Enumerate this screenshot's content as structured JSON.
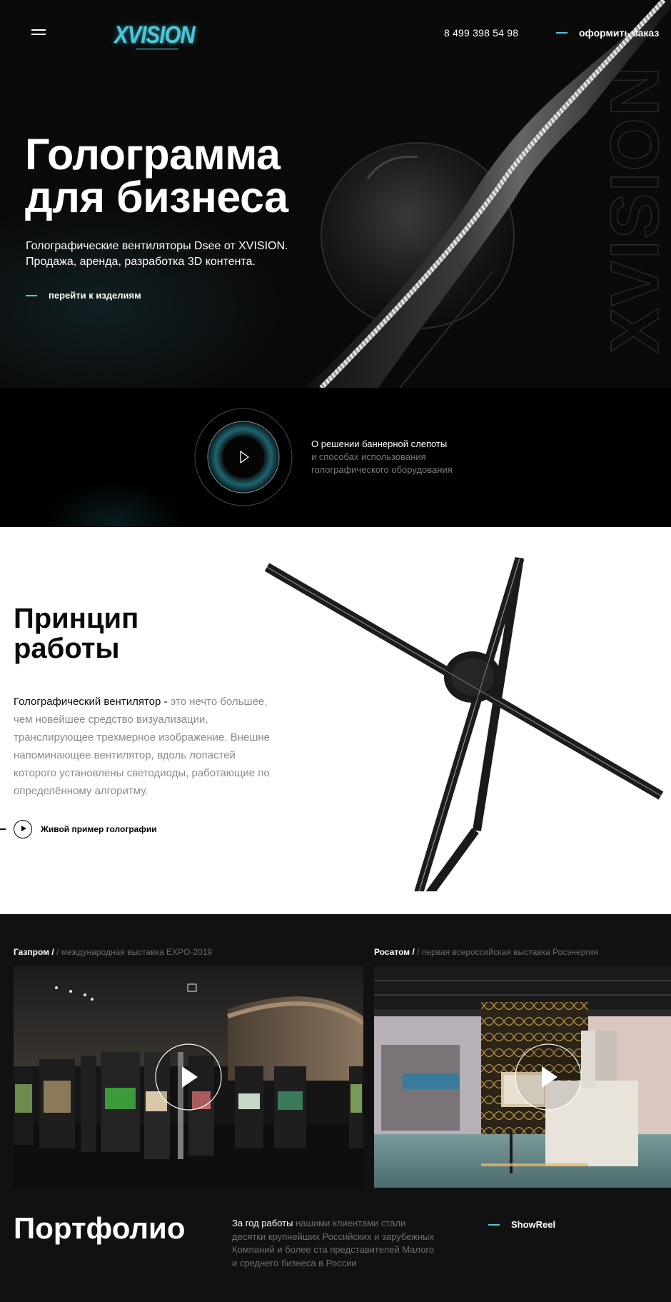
{
  "header": {
    "menu_icon": "hamburger-icon",
    "logo_text": "XVISION",
    "phone": "8 499 398 54 98",
    "order_label": "оформить заказ"
  },
  "hero": {
    "title_line1": "Голограмма",
    "title_line2": "для бизнеса",
    "subtitle_line1": "Голографические вентиляторы Dsee от XVISION.",
    "subtitle_line2": "Продажа, аренда, разработка 3D контента.",
    "products_link": "перейти к изделиям",
    "watermark": "XVISION"
  },
  "video_strip": {
    "play_icon": "play-icon",
    "line1": "О решении баннерной слепоты",
    "line2": "и способах использования",
    "line3": "голографического оборудования"
  },
  "principle": {
    "title_line1": "Принцип",
    "title_line2": "работы",
    "text_highlight": "Голографический вентилятор -",
    "text_rest": " это нечто большее, чем новейшее средство визуализации, транслирующее трехмерное изображение. Внешне напоминающее вентилятор, вдоль лопастей которого установлены светодиоды, работающие по определённому алгоритму.",
    "live_link": "Живой пример голографии"
  },
  "portfolio": {
    "cases": [
      {
        "client": "Газпром /",
        "event": " / международная выставка EXPO-2019"
      },
      {
        "client": "Росатом /",
        "event": " / первая всероссийская выставка Росэнергия"
      }
    ],
    "title": "Портфолио",
    "text_highlight": "За год работы",
    "text_rest": " нашими клиентами стали десятки крупнейших Российских и зарубежных Компаний и более ста представителей Малого и среднего бизнеса в России",
    "showreel_label": "ShowReel"
  },
  "colors": {
    "accent": "#4fc6d8",
    "dark_bg": "#0a0a0a",
    "portfolio_bg": "#111112",
    "light_bg": "#ffffff"
  }
}
